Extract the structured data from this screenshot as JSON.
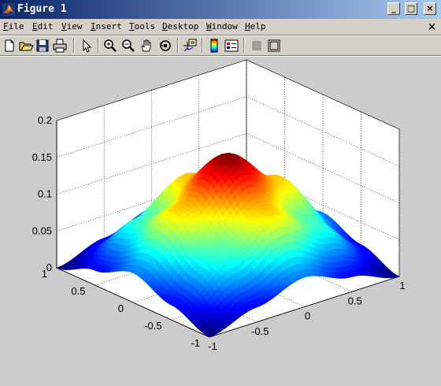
{
  "window": {
    "title": "Figure 1",
    "buttons": {
      "minimize": "_",
      "maximize": "□",
      "close": "×"
    }
  },
  "menu": {
    "items": [
      {
        "key": "F",
        "rest": "ile"
      },
      {
        "key": "E",
        "rest": "dit"
      },
      {
        "key": "V",
        "rest": "iew"
      },
      {
        "key": "I",
        "rest": "nsert"
      },
      {
        "key": "T",
        "rest": "ools"
      },
      {
        "key": "D",
        "rest": "esktop"
      },
      {
        "key": "W",
        "rest": "indow"
      },
      {
        "key": "H",
        "rest": "elp"
      }
    ],
    "doc_close": "×"
  },
  "toolbar": {
    "tools": [
      "new-figure-icon",
      "open-file-icon",
      "save-icon",
      "print-icon",
      "select-arrow-icon",
      "zoom-in-icon",
      "zoom-out-icon",
      "pan-hand-icon",
      "rotate-3d-icon",
      "data-cursor-icon",
      "colorbar-icon",
      "legend-icon",
      "hide-plot-tools-icon",
      "show-plot-tools-icon"
    ]
  },
  "chart_data": {
    "type": "surface",
    "function": "peaked surface, max ≈ 0.16 at (0,0), falling to 0 at the corners (±1,±1)",
    "x": [
      -1,
      -0.5,
      0,
      0.5,
      1
    ],
    "y": [
      -1,
      -0.5,
      0,
      0.5,
      1
    ],
    "z_grid_sample": [
      [
        0.0,
        0.02,
        0.04,
        0.02,
        0.0
      ],
      [
        0.02,
        0.07,
        0.11,
        0.07,
        0.02
      ],
      [
        0.04,
        0.11,
        0.16,
        0.11,
        0.04
      ],
      [
        0.02,
        0.07,
        0.11,
        0.07,
        0.02
      ],
      [
        0.0,
        0.02,
        0.04,
        0.02,
        0.0
      ]
    ],
    "xlim": [
      -1,
      1
    ],
    "ylim": [
      -1,
      1
    ],
    "zlim": [
      0,
      0.2
    ],
    "xticks": [
      "-1",
      "-0.5",
      "0",
      "0.5",
      "1"
    ],
    "yticks": [
      "-1",
      "-0.5",
      "0",
      "0.5",
      "1"
    ],
    "zticks": [
      "0",
      "0.05",
      "0.1",
      "0.15",
      "0.2"
    ],
    "colormap": "jet",
    "grid": true,
    "background": "#cccccc",
    "title": "",
    "xlabel": "",
    "ylabel": "",
    "zlabel": ""
  }
}
